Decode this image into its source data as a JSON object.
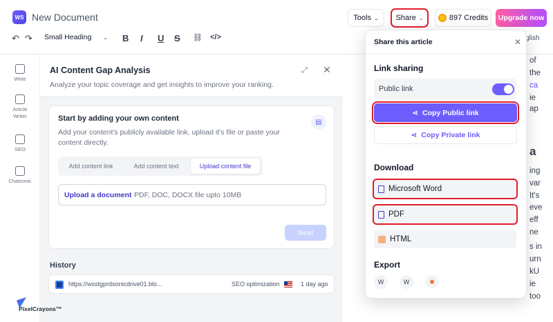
{
  "header": {
    "logo_text": "WS",
    "doc_title": "New Document",
    "tools_label": "Tools",
    "share_label": "Share",
    "credits_label": "897 Credits",
    "upgrade_label": "Upgrade now"
  },
  "toolbar": {
    "undo": "↶",
    "redo": "↷",
    "heading_select": "Small Heading",
    "bold": "B",
    "italic": "I",
    "underline": "U",
    "strike": "S",
    "link": "⛓",
    "code": "</>",
    "language_fragment": "glish"
  },
  "rail": {
    "items": [
      {
        "label": "Write"
      },
      {
        "label": "Article Writer"
      },
      {
        "label": "SEO"
      },
      {
        "label": "Chatsonic"
      }
    ]
  },
  "panel": {
    "title": "AI Content Gap Analysis",
    "subtitle": "Analyze your topic coverage and get insights to improve your ranking.",
    "card": {
      "title": "Start by adding your own content",
      "description": "Add your content's publicly available link, upload it's file or paste your content directly.",
      "tabs": [
        {
          "label": "Add content link"
        },
        {
          "label": "Add content text"
        },
        {
          "label": "Upload content file"
        }
      ],
      "upload_link": "Upload a document",
      "upload_hint": "PDF, DOC, DOCX file upto 10MB",
      "next_label": "Next"
    },
    "history": {
      "title": "History",
      "rows": [
        {
          "url": "https://wsstgprdsonicdrive01.blo...",
          "type": "SEO optimization",
          "time": "1 day ago"
        }
      ]
    }
  },
  "background_text": [
    "of",
    "the",
    "ca",
    "ie",
    "ap",
    "a",
    "ing",
    "var",
    "It's",
    "eve",
    "eff",
    "ne",
    "s in",
    "urn",
    "kU",
    "ie",
    "too"
  ],
  "share_popover": {
    "title": "Share this article",
    "link_sharing_title": "Link sharing",
    "public_link_label": "Public link",
    "public_link_enabled": true,
    "copy_public_label": "Copy Public link",
    "copy_private_label": "Copy Private link",
    "download_title": "Download",
    "downloads": [
      {
        "label": "Microsoft Word"
      },
      {
        "label": "PDF"
      },
      {
        "label": "HTML"
      }
    ],
    "export_title": "Export",
    "export_icons": [
      "wordpress-icon",
      "wordpress-icon",
      "hubspot-icon"
    ]
  },
  "watermark": {
    "text": "PixelCrayons™"
  },
  "colors": {
    "accent": "#6d5dfc",
    "highlight_red": "#e11d2a",
    "upgrade_gradient_start": "#ff5fa2",
    "upgrade_gradient_end": "#b14dff"
  }
}
